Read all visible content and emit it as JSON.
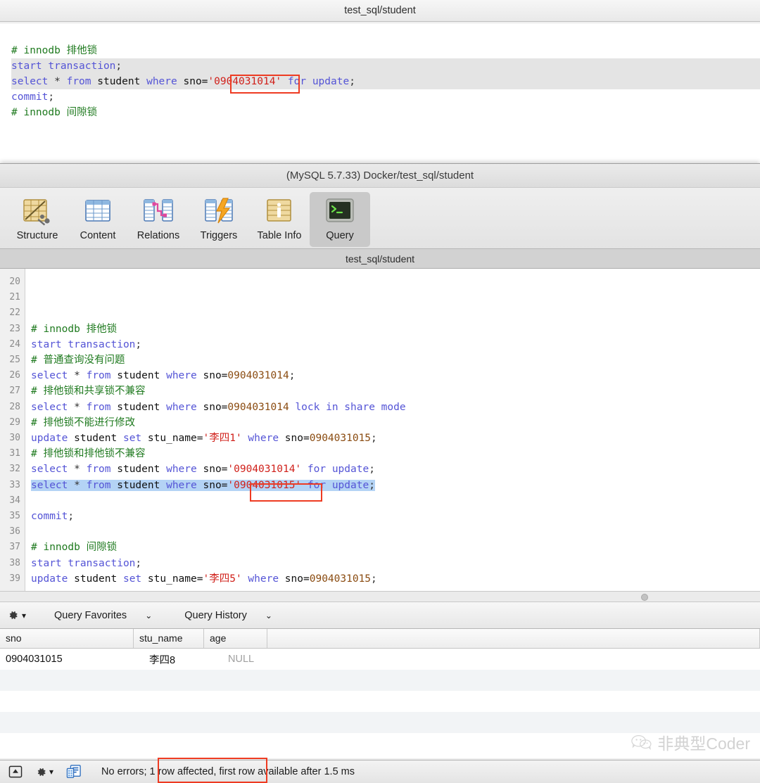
{
  "background_window": {
    "title": "test_sql/student",
    "code_lines": [
      {
        "tokens": [
          {
            "t": "# innodb 排他锁",
            "c": "cmt"
          }
        ],
        "band": false
      },
      {
        "tokens": [
          {
            "t": "start transaction",
            "c": "kw"
          },
          {
            "t": ";",
            "c": "punc"
          }
        ],
        "band": true
      },
      {
        "tokens": [
          {
            "t": "select",
            "c": "kw"
          },
          {
            "t": " * ",
            "c": "punc"
          },
          {
            "t": "from",
            "c": "kw"
          },
          {
            "t": " student ",
            "c": "id"
          },
          {
            "t": "where",
            "c": "kw"
          },
          {
            "t": " sno=",
            "c": "id"
          },
          {
            "t": "'0904031014'",
            "c": "str"
          },
          {
            "t": " ",
            "c": "id"
          },
          {
            "t": "for update",
            "c": "kw"
          },
          {
            "t": ";",
            "c": "punc"
          }
        ],
        "band": true
      },
      {
        "tokens": [
          {
            "t": "",
            "c": "id"
          }
        ],
        "band": false
      },
      {
        "tokens": [
          {
            "t": "commit",
            "c": "kw"
          },
          {
            "t": ";",
            "c": "punc"
          }
        ],
        "band": false
      },
      {
        "tokens": [
          {
            "t": "",
            "c": "id"
          }
        ],
        "band": false
      },
      {
        "tokens": [
          {
            "t": "",
            "c": "id"
          }
        ],
        "band": false
      },
      {
        "tokens": [
          {
            "t": "# innodb 间隙锁",
            "c": "cmt"
          }
        ],
        "band": false
      }
    ]
  },
  "window": {
    "title": "(MySQL 5.7.33) Docker/test_sql/student",
    "tab_label": "test_sql/student"
  },
  "toolbar": {
    "items": [
      {
        "label": "Structure",
        "icon": "structure-icon",
        "active": false
      },
      {
        "label": "Content",
        "icon": "content-icon",
        "active": false
      },
      {
        "label": "Relations",
        "icon": "relations-icon",
        "active": false
      },
      {
        "label": "Triggers",
        "icon": "triggers-icon",
        "active": false
      },
      {
        "label": "Table Info",
        "icon": "table-info-icon",
        "active": false
      },
      {
        "label": "Query",
        "icon": "query-terminal-icon",
        "active": true
      }
    ]
  },
  "editor": {
    "first_line_number": 20,
    "lines": [
      {
        "n": 20,
        "tokens": [],
        "selected": false
      },
      {
        "n": 21,
        "tokens": [],
        "selected": false
      },
      {
        "n": 22,
        "tokens": [],
        "selected": false
      },
      {
        "n": 23,
        "tokens": [
          {
            "t": "# innodb 排他锁",
            "c": "cmt"
          }
        ],
        "selected": false
      },
      {
        "n": 24,
        "tokens": [
          {
            "t": "start transaction",
            "c": "kw"
          },
          {
            "t": ";",
            "c": "punc"
          }
        ],
        "selected": false
      },
      {
        "n": 25,
        "tokens": [
          {
            "t": "# 普通查询没有问题",
            "c": "cmt"
          }
        ],
        "selected": false
      },
      {
        "n": 26,
        "tokens": [
          {
            "t": "select",
            "c": "kw"
          },
          {
            "t": " * ",
            "c": "punc"
          },
          {
            "t": "from",
            "c": "kw"
          },
          {
            "t": " student ",
            "c": "id"
          },
          {
            "t": "where",
            "c": "kw"
          },
          {
            "t": " sno=",
            "c": "id"
          },
          {
            "t": "0904031014",
            "c": "num"
          },
          {
            "t": ";",
            "c": "punc"
          }
        ],
        "selected": false
      },
      {
        "n": 27,
        "tokens": [
          {
            "t": "# 排他锁和共享锁不兼容",
            "c": "cmt"
          }
        ],
        "selected": false
      },
      {
        "n": 28,
        "tokens": [
          {
            "t": "select",
            "c": "kw"
          },
          {
            "t": " * ",
            "c": "punc"
          },
          {
            "t": "from",
            "c": "kw"
          },
          {
            "t": " student ",
            "c": "id"
          },
          {
            "t": "where",
            "c": "kw"
          },
          {
            "t": " sno=",
            "c": "id"
          },
          {
            "t": "0904031014",
            "c": "num"
          },
          {
            "t": " ",
            "c": "id"
          },
          {
            "t": "lock in share mode",
            "c": "kw"
          }
        ],
        "selected": false
      },
      {
        "n": 29,
        "tokens": [
          {
            "t": "# 排他锁不能进行修改",
            "c": "cmt"
          }
        ],
        "selected": false
      },
      {
        "n": 30,
        "tokens": [
          {
            "t": "update",
            "c": "kw"
          },
          {
            "t": " student ",
            "c": "id"
          },
          {
            "t": "set",
            "c": "kw"
          },
          {
            "t": " stu_name=",
            "c": "id"
          },
          {
            "t": "'李四1'",
            "c": "str"
          },
          {
            "t": " ",
            "c": "id"
          },
          {
            "t": "where",
            "c": "kw"
          },
          {
            "t": " sno=",
            "c": "id"
          },
          {
            "t": "0904031015",
            "c": "num"
          },
          {
            "t": ";",
            "c": "punc"
          }
        ],
        "selected": false
      },
      {
        "n": 31,
        "tokens": [
          {
            "t": "# 排他锁和排他锁不兼容",
            "c": "cmt"
          }
        ],
        "selected": false
      },
      {
        "n": 32,
        "tokens": [
          {
            "t": "select",
            "c": "kw"
          },
          {
            "t": " * ",
            "c": "punc"
          },
          {
            "t": "from",
            "c": "kw"
          },
          {
            "t": " student ",
            "c": "id"
          },
          {
            "t": "where",
            "c": "kw"
          },
          {
            "t": " sno=",
            "c": "id"
          },
          {
            "t": "'0904031014'",
            "c": "str"
          },
          {
            "t": " ",
            "c": "id"
          },
          {
            "t": "for update",
            "c": "kw"
          },
          {
            "t": ";",
            "c": "punc"
          }
        ],
        "selected": false
      },
      {
        "n": 33,
        "tokens": [
          {
            "t": "select",
            "c": "kw"
          },
          {
            "t": " * ",
            "c": "punc"
          },
          {
            "t": "from",
            "c": "kw"
          },
          {
            "t": " student ",
            "c": "id"
          },
          {
            "t": "where",
            "c": "kw"
          },
          {
            "t": " sno=",
            "c": "id"
          },
          {
            "t": "'0904031015'",
            "c": "str"
          },
          {
            "t": " ",
            "c": "id"
          },
          {
            "t": "for update",
            "c": "kw"
          },
          {
            "t": ";",
            "c": "punc"
          }
        ],
        "selected": true
      },
      {
        "n": 34,
        "tokens": [],
        "selected": false
      },
      {
        "n": 35,
        "tokens": [
          {
            "t": "commit",
            "c": "kw"
          },
          {
            "t": ";",
            "c": "punc"
          }
        ],
        "selected": false
      },
      {
        "n": 36,
        "tokens": [],
        "selected": false
      },
      {
        "n": 37,
        "tokens": [
          {
            "t": "# innodb 间隙锁",
            "c": "cmt"
          }
        ],
        "selected": false
      },
      {
        "n": 38,
        "tokens": [
          {
            "t": "start transaction",
            "c": "kw"
          },
          {
            "t": ";",
            "c": "punc"
          }
        ],
        "selected": false
      },
      {
        "n": 39,
        "tokens": [
          {
            "t": "update",
            "c": "kw"
          },
          {
            "t": " student ",
            "c": "id"
          },
          {
            "t": "set",
            "c": "kw"
          },
          {
            "t": " stu_name=",
            "c": "id"
          },
          {
            "t": "'李四5'",
            "c": "str"
          },
          {
            "t": " ",
            "c": "id"
          },
          {
            "t": "where",
            "c": "kw"
          },
          {
            "t": " sno=",
            "c": "id"
          },
          {
            "t": "0904031015",
            "c": "num"
          },
          {
            "t": ";",
            "c": "punc"
          }
        ],
        "selected": false
      }
    ]
  },
  "favorites_bar": {
    "gear_icon": "gear-icon",
    "query_favorites_label": "Query Favorites",
    "query_history_label": "Query History"
  },
  "results": {
    "columns": [
      "sno",
      "stu_name",
      "age"
    ],
    "rows": [
      {
        "sno": "0904031015",
        "stu_name": "李四8",
        "age": "NULL"
      }
    ]
  },
  "status_bar": {
    "message": "No errors; 1 row affected, first row available after 1.5 ms",
    "icons": [
      "show-console-icon",
      "gear-icon",
      "query-info-icon"
    ]
  },
  "watermark": {
    "text": "非典型Coder",
    "icon": "wechat-icon"
  },
  "annotation_color": "#ee3b22"
}
